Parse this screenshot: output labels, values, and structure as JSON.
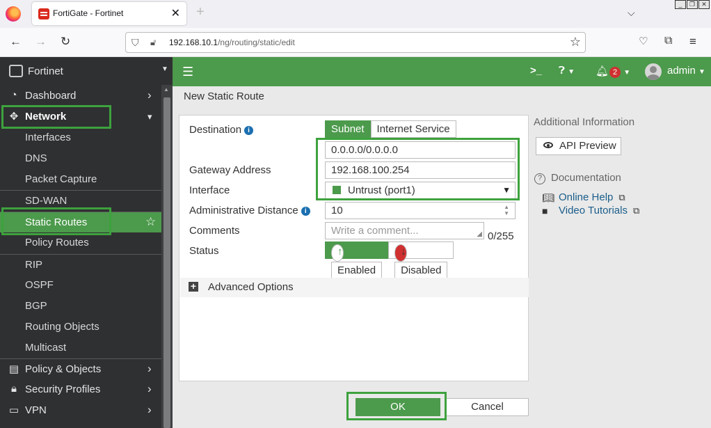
{
  "browser": {
    "tab_title": "FortiGate - Fortinet",
    "url_host": "192.168.10.1",
    "url_path": "/ng/routing/static/edit"
  },
  "sidebar": {
    "brand": "Fortinet",
    "items": [
      {
        "label": "Dashboard"
      },
      {
        "label": "Network"
      },
      {
        "label": "Interfaces"
      },
      {
        "label": "DNS"
      },
      {
        "label": "Packet Capture"
      },
      {
        "label": "SD-WAN"
      },
      {
        "label": "Static Routes"
      },
      {
        "label": "Policy Routes"
      },
      {
        "label": "RIP"
      },
      {
        "label": "OSPF"
      },
      {
        "label": "BGP"
      },
      {
        "label": "Routing Objects"
      },
      {
        "label": "Multicast"
      },
      {
        "label": "Policy & Objects"
      },
      {
        "label": "Security Profiles"
      },
      {
        "label": "VPN"
      }
    ]
  },
  "header": {
    "alerts_count": "2",
    "user": "admin"
  },
  "page": {
    "title": "New Static Route"
  },
  "form": {
    "destination_label": "Destination",
    "dest_type_subnet": "Subnet",
    "dest_type_internet_service": "Internet Service",
    "destination_value": "0.0.0.0/0.0.0.0",
    "gateway_label": "Gateway Address",
    "gateway_value": "192.168.100.254",
    "interface_label": "Interface",
    "interface_value": "Untrust (port1)",
    "admin_distance_label": "Administrative Distance",
    "admin_distance_value": "10",
    "comments_label": "Comments",
    "comments_placeholder": "Write a comment...",
    "comments_counter": "0/255",
    "status_label": "Status",
    "status_enabled": "Enabled",
    "status_disabled": "Disabled",
    "advanced_options": "Advanced Options"
  },
  "side": {
    "additional_info": "Additional Information",
    "api_preview": "API Preview",
    "documentation": "Documentation",
    "online_help": "Online Help",
    "video_tutorials": "Video Tutorials"
  },
  "buttons": {
    "ok": "OK",
    "cancel": "Cancel"
  },
  "colors": {
    "accent": "#4c9a4c",
    "highlight": "#3da23d",
    "sidebar_bg": "#2f3032"
  }
}
